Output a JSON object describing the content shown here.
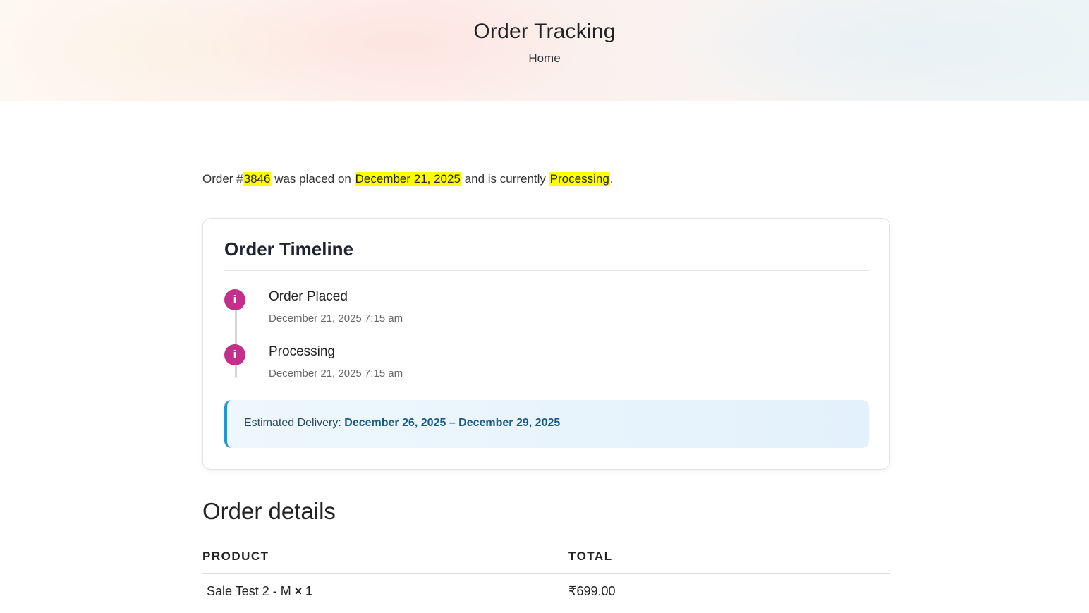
{
  "hero": {
    "title": "Order Tracking",
    "breadcrumb": "Home"
  },
  "status": {
    "prefix": "Order #",
    "order_number": "3846",
    "placed_text": " was placed on ",
    "placed_date": "December 21, 2025",
    "currently_text": " and is currently ",
    "status": "Processing",
    "suffix": "."
  },
  "timeline": {
    "title": "Order Timeline",
    "icon_glyph": "i",
    "events": [
      {
        "title": "Order Placed",
        "date": "December 21, 2025 7:15 am"
      },
      {
        "title": "Processing",
        "date": "December 21, 2025 7:15 am"
      }
    ],
    "delivery_label": "Estimated Delivery: ",
    "delivery_value": "December 26, 2025 – December 29, 2025"
  },
  "details": {
    "title": "Order details",
    "columns": [
      "PRODUCT",
      "TOTAL"
    ],
    "rows": [
      {
        "product": "Sale Test 2 - M",
        "qty": "× 1",
        "total": "₹699.00"
      }
    ]
  },
  "colors": {
    "highlight": "#ffff00",
    "timeline_dot": "#c2308a",
    "delivery_accent": "#1f97d6"
  }
}
